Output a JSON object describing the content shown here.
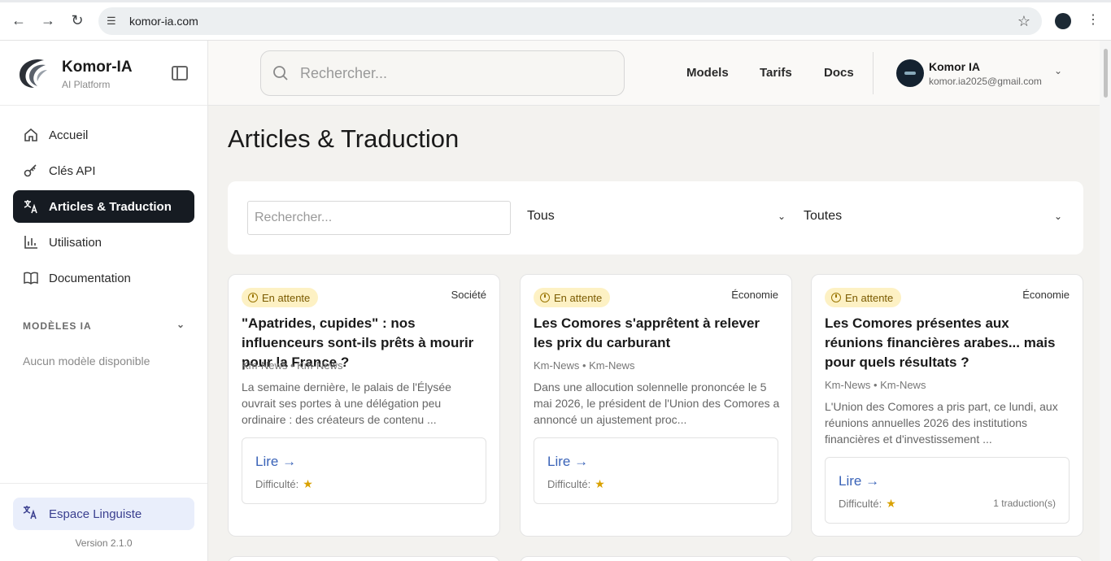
{
  "browser": {
    "url": "komor-ia.com"
  },
  "sidebar": {
    "brand_name": "Komor-IA",
    "brand_sub": "AI Platform",
    "items": [
      {
        "label": "Accueil",
        "icon": "home-icon"
      },
      {
        "label": "Clés API",
        "icon": "key-icon"
      },
      {
        "label": "Articles & Traduction",
        "icon": "translate-icon",
        "active": true
      },
      {
        "label": "Utilisation",
        "icon": "bar-chart-icon"
      },
      {
        "label": "Documentation",
        "icon": "book-icon"
      }
    ],
    "models_heading": "MODÈLES IA",
    "models_empty": "Aucun modèle disponible",
    "linguist_label": "Espace Linguiste",
    "version": "Version 2.1.0"
  },
  "header": {
    "search_placeholder": "Rechercher...",
    "links": [
      "Models",
      "Tarifs",
      "Docs"
    ],
    "user_name": "Komor IA",
    "user_email": "komor.ia2025@gmail.com"
  },
  "main": {
    "title": "Articles & Traduction",
    "filters": {
      "search_placeholder": "Rechercher...",
      "status_value": "Tous",
      "category_value": "Toutes"
    },
    "cards": [
      {
        "status": "En attente",
        "category": "Société",
        "title": "\"Apatrides, cupides\" : nos influenceurs sont-ils prêts à mourir pour la France ?",
        "source": "Km-News • Km-News",
        "excerpt": "La semaine dernière, le palais de l'Élysée ouvrait ses portes à une délégation peu ordinaire : des créateurs de contenu ...",
        "read_label": "Lire →",
        "difficulty_label": "Difficulté:",
        "translations": ""
      },
      {
        "status": "En attente",
        "category": "Économie",
        "title": "Les Comores s'apprêtent à relever les prix du carburant",
        "source": "Km-News • Km-News",
        "excerpt": "Dans une allocution solennelle prononcée le 5 mai 2026, le président de l'Union des Comores a annoncé un ajustement proc...",
        "read_label": "Lire →",
        "difficulty_label": "Difficulté:",
        "translations": ""
      },
      {
        "status": "En attente",
        "category": "Économie",
        "title": "Les Comores présentes aux réunions financières arabes... mais pour quels résultats ?",
        "source": "Km-News • Km-News",
        "excerpt": "L'Union des Comores a pris part, ce lundi, aux réunions annuelles 2026 des institutions financières et d'investissement ...",
        "read_label": "Lire →",
        "difficulty_label": "Difficulté:",
        "translations": "1 traduction(s)"
      }
    ]
  }
}
